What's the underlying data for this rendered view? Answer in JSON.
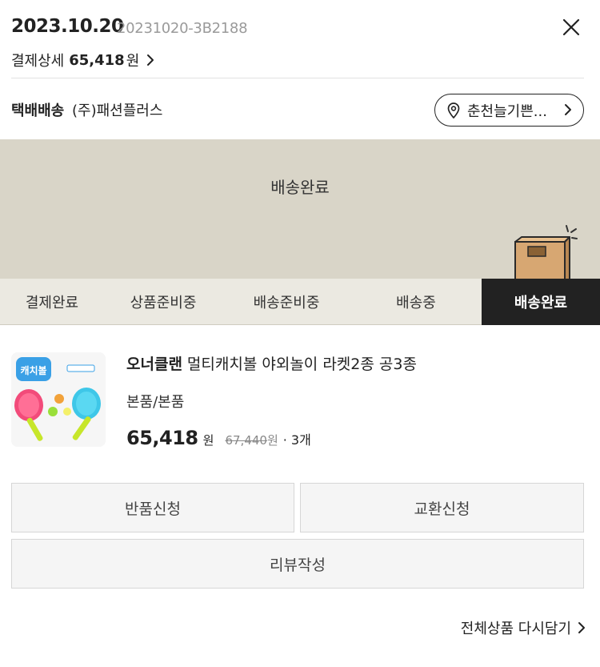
{
  "header": {
    "date": "2023.10.20",
    "order_no": "20231020-3B2188",
    "pay_label": "결제상세",
    "pay_amount": "65,418",
    "pay_won": "원"
  },
  "shipping": {
    "type": "택배배송",
    "company": "(주)패션플러스",
    "address_button": "춘천늘기쁜..."
  },
  "banner": {
    "status_title": "배송완료",
    "background_color": "#d9d5c8"
  },
  "steps": [
    {
      "label": "결제완료",
      "active": false
    },
    {
      "label": "상품준비중",
      "active": false
    },
    {
      "label": "배송준비중",
      "active": false
    },
    {
      "label": "배송중",
      "active": false
    },
    {
      "label": "배송완료",
      "active": true
    }
  ],
  "product": {
    "brand": "오너클랜",
    "name": "멀티캐치볼 야외놀이 라켓2종 공3종",
    "option": "본품/본품",
    "price": "65,418",
    "price_won": "원",
    "original_price": "67,440",
    "original_won": "원",
    "quantity": "· 3개",
    "thumbnail_text": "캐치볼"
  },
  "buttons": {
    "return": "반품신청",
    "exchange": "교환신청",
    "review": "리뷰작성"
  },
  "footer": {
    "re_cart": "전체상품 다시담기"
  },
  "icons": [
    "close-icon",
    "chevron-right-icon",
    "location-pin-icon",
    "delivery-box-icon"
  ]
}
